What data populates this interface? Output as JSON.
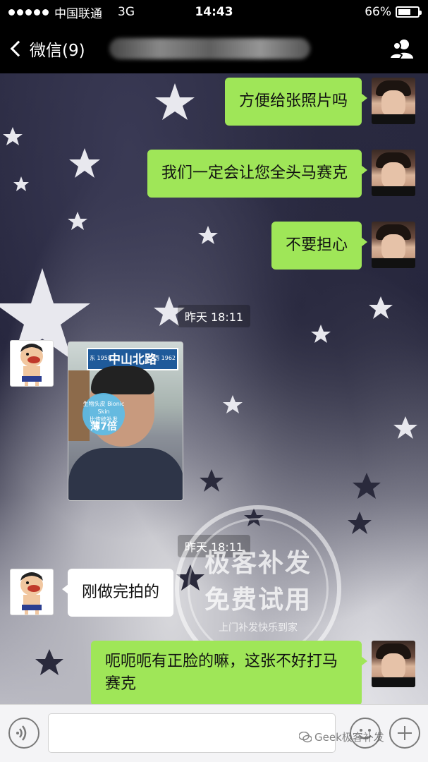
{
  "status_bar": {
    "carrier": "中国联通",
    "network": "3G",
    "time": "14:43",
    "battery_text": "66%",
    "battery_level": 0.66
  },
  "nav": {
    "back_label": "微信(9)",
    "contact_icon": "contacts-icon"
  },
  "messages": [
    {
      "text": "方便给张照片吗",
      "sender": "me"
    },
    {
      "text": "我们一定会让您全头马赛克",
      "sender": "me"
    },
    {
      "text": "不要担心",
      "sender": "me"
    },
    {
      "text": "刚做完拍的",
      "sender": "other"
    },
    {
      "text": "呃呃呃有正脸的嘛，这张不好打马赛克",
      "sender": "me"
    }
  ],
  "timestamps": [
    "昨天 18:11",
    "昨天 18:11"
  ],
  "photo": {
    "street_sign": "中山北路",
    "sign_small_left": "东 1958",
    "sign_small_right": "西 1962",
    "badge_brand": "生物头皮 Bionic Skin",
    "badge_line": "比传统补发",
    "badge_value": "薄7倍"
  },
  "watermark": {
    "line1": "极客补发",
    "line2": "免费试用",
    "line3": "上门补发快乐到家"
  },
  "footer_mark": "Geek极客补发",
  "colors": {
    "green_bubble": "#9fe658",
    "white_bubble": "#ffffff",
    "bar_bg": "#000000"
  }
}
